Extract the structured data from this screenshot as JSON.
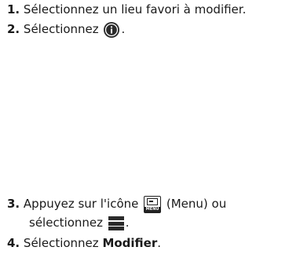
{
  "steps": [
    {
      "number": "1.",
      "text": "Sélectionnez un lieu favori à modifier."
    },
    {
      "number": "2.",
      "text_before": "Sélectionnez ",
      "text_after": ".",
      "icon": "info-icon"
    },
    {
      "number": "3.",
      "line1_before": "Appuyez sur l'icône ",
      "line1_after": " (Menu) ou",
      "line2_before": "sélectionnez ",
      "line2_after": ".",
      "key_icon": "menu-key-icon",
      "key_label": "MENU",
      "list_icon": "hamburger-menu-icon"
    },
    {
      "number": "4.",
      "text_before": "Sélectionnez ",
      "term": "Modifier",
      "text_after": "."
    }
  ]
}
